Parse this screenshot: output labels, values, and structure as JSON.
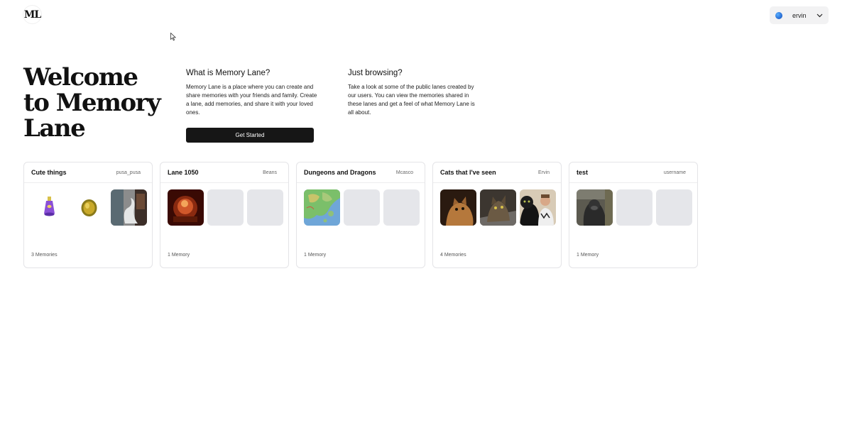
{
  "brand": {
    "logo_text": "ML"
  },
  "user_menu": {
    "name": "ervin"
  },
  "hero": {
    "title": "Welcome to Memory Lane",
    "about_heading": "What is Memory Lane?",
    "about_text": "Memory Lane is a place where you can create and share memories with your friends and family. Create a lane, add memories, and share it with your loved ones.",
    "cta_label": "Get Started",
    "browse_heading": "Just browsing?",
    "browse_text": "Take a look at some of the public lanes created by our users. You can view the memories shared in these lanes and get a feel of what Memory Lane is all about."
  },
  "lanes": [
    {
      "title": "Cute things",
      "owner": "pusa_pusa",
      "count": "3 Memories"
    },
    {
      "title": "Lane 1050",
      "owner": "Beans",
      "count": "1 Memory"
    },
    {
      "title": "Dungeons and Dragons",
      "owner": "Mcasco",
      "count": "1 Memory"
    },
    {
      "title": "Cats that I've seen",
      "owner": "Ervin",
      "count": "4 Memories"
    },
    {
      "title": "test",
      "owner": "username",
      "count": "1 Memory"
    }
  ],
  "icons": {
    "user_avatar": "globe-avatar-icon",
    "user_menu_toggle": "chevron-down-icon",
    "cursor": "mouse-pointer-icon"
  },
  "colors": {
    "cta_background": "#161616",
    "placeholder": "#e5e6ea",
    "card_border": "#e4e4e7"
  }
}
